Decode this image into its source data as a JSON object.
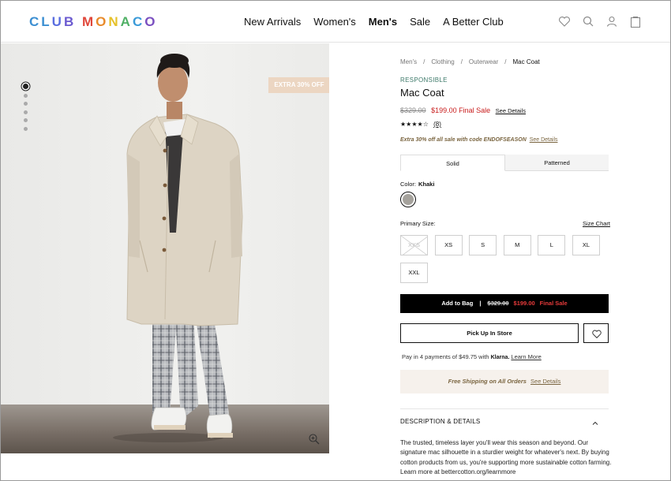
{
  "header": {
    "logo": {
      "letters": [
        "C",
        "L",
        "U",
        "B",
        " ",
        "M",
        "O",
        "N",
        "A",
        "C",
        "O"
      ],
      "colors": [
        "#3c8fd2",
        "#3c8fd2",
        "#5a6ee0",
        "#6b5ad0",
        "#ffffff",
        "#e0473a",
        "#e88a2a",
        "#e6c12a",
        "#4fb065",
        "#3a9ad8",
        "#7a4fc0"
      ]
    },
    "nav": [
      "New Arrivals",
      "Women's",
      "Men's",
      "Sale",
      "A Better Club"
    ],
    "nav_active": "Men's",
    "icons": [
      "heart-icon",
      "search-icon",
      "account-icon",
      "bag-icon"
    ]
  },
  "gallery": {
    "badge": "EXTRA 30% OFF",
    "dot_count": 6,
    "active_dot": 1,
    "zoom_icon": "zoom-in-icon"
  },
  "breadcrumb": [
    "Men's",
    "Clothing",
    "Outerwear",
    "Mac Coat"
  ],
  "product": {
    "tag": "RESPONSIBLE",
    "name": "Mac Coat",
    "price_original": "$329.00",
    "price_sale": "$199.00 Final Sale",
    "see_details": "See Details",
    "stars": "★★★★☆",
    "rating_value": 3.5,
    "review_count": "(8)",
    "promo": "Extra 30% off all sale with code ENDOFSEASON",
    "promo_link": "See Details"
  },
  "options": {
    "tabs": [
      "Solid",
      "Patterned"
    ],
    "active_tab": "Solid",
    "color_label": "Color:",
    "color_value": "Khaki",
    "swatch_color": "#a5a29c",
    "size_label": "Primary Size:",
    "size_chart": "Size Chart",
    "sizes": [
      "XXS",
      "XS",
      "S",
      "M",
      "L",
      "XL",
      "XXL"
    ],
    "unavailable_sizes": [
      "XXS"
    ]
  },
  "actions": {
    "add_to_bag": "Add to Bag",
    "bag_separator": "|",
    "bag_old_price": "$329.00",
    "bag_new_price": "$199.00",
    "bag_final_sale": "Final Sale",
    "pickup": "Pick Up In Store",
    "klarna_prefix": "Pay in 4 payments of $49.75 with",
    "klarna_brand": "Klarna.",
    "klarna_link": "Learn More",
    "shipping": "Free Shipping on All Orders",
    "shipping_link": "See Details"
  },
  "description": {
    "heading": "DESCRIPTION & DETAILS",
    "text": "The trusted, timeless layer you'll wear this season and beyond. Our signature mac silhouette in a sturdier weight for whatever's next. By buying cotton products from us, you're supporting more sustainable cotton farming. Learn more at bettercotton.org/learnmore"
  },
  "colors": {
    "sale_red": "#c81c1c",
    "responsible_green": "#3e7a6a",
    "promo_brown": "#7a6540",
    "badge_bg": "#ecd6c2",
    "shipping_bg": "#f6f1ec"
  }
}
